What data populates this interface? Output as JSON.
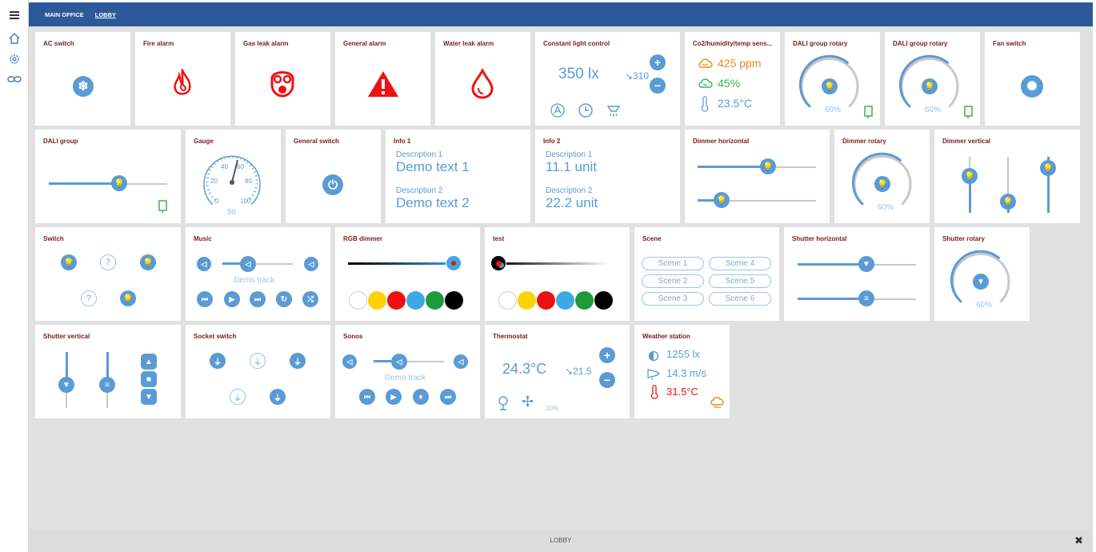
{
  "nav": {
    "breadcrumbs": [
      "MAIN OFFICE",
      "LOBBY"
    ]
  },
  "sidebar": {
    "icons": [
      "menu-icon",
      "home-icon",
      "settings-icon",
      "link-icon"
    ]
  },
  "tiles": {
    "ac_switch": {
      "title": "AC switch"
    },
    "fire_alarm": {
      "title": "Fire alarm"
    },
    "gas_leak_alarm": {
      "title": "Gas leak alarm"
    },
    "general_alarm": {
      "title": "General alarm"
    },
    "water_leak_alarm": {
      "title": "Water leak alarm"
    },
    "constant_light": {
      "title": "Constant light control",
      "value": "350 lx",
      "setpoint": "↘310"
    },
    "co2": {
      "title": "Co2/humidity/temp sens...",
      "co2": "425 ppm",
      "humidity": "45%",
      "temp": "23.5°C"
    },
    "dali_rotary_1": {
      "title": "DALI group rotary",
      "value": "60%",
      "level": 0.6
    },
    "dali_rotary_2": {
      "title": "DALI group rotary",
      "value": "60%",
      "level": 0.6
    },
    "fan_switch": {
      "title": "Fan switch"
    },
    "dali_group": {
      "title": "DALI group",
      "level": 0.6
    },
    "gauge": {
      "title": "Gauge",
      "ticks": [
        "0",
        "20",
        "40",
        "60",
        "80",
        "100"
      ],
      "value": "58"
    },
    "general_switch": {
      "title": "General switch"
    },
    "info1": {
      "title": "Info 1",
      "desc1": "Description 1",
      "val1": "Demo text 1",
      "desc2": "Description 2",
      "val2": "Demo text 2"
    },
    "info2": {
      "title": "Info 2",
      "desc1": "Description 1",
      "val1": "11.1 unit",
      "desc2": "Description 2",
      "val2": "22.2 unit"
    },
    "dimmer_horizontal": {
      "title": "Dimmer horizontal",
      "level1": 0.6,
      "level2": 0.2
    },
    "dimmer_rotary": {
      "title": "Dimmer rotary",
      "value": "60%",
      "level": 0.6
    },
    "dimmer_vertical": {
      "title": "Dimmer vertical"
    },
    "switch": {
      "title": "Switch"
    },
    "music": {
      "title": "Music",
      "track": "Demo track"
    },
    "rgb_dimmer": {
      "title": "RGB dimmer"
    },
    "test": {
      "title": "test"
    },
    "scene": {
      "title": "Scene",
      "scenes": [
        "Scene 1",
        "Scene 4",
        "Scene 2",
        "Scene 5",
        "Scene 3",
        "Scene 6"
      ]
    },
    "shutter_horizontal": {
      "title": "Shutter horizontal"
    },
    "shutter_rotary": {
      "title": "Shutter rotary",
      "value": "60%",
      "level": 0.6
    },
    "shutter_vertical": {
      "title": "Shutter vertical"
    },
    "socket_switch": {
      "title": "Socket switch"
    },
    "sonos": {
      "title": "Sonos",
      "track": "Demo track"
    },
    "thermostat": {
      "title": "Thermostat",
      "value": "24.3°C",
      "setpoint": "↘21.5",
      "fan": "30%"
    },
    "weather": {
      "title": "Weather station",
      "lux": "1255 lx",
      "wind": "14.3 m/s",
      "temp": "31.5°C"
    }
  },
  "colors": {
    "accent": "#5a9bd4",
    "header": "#2c5a99",
    "alarm": "#ee1111",
    "title": "#7a1c1c",
    "orange": "#e88a1a",
    "green": "#3cb44b",
    "swatches": [
      "#ffffff",
      "#ffd200",
      "#ee1111",
      "#3ea8e5",
      "#1e9a3a",
      "#000000"
    ]
  },
  "footer": {
    "label": "LOBBY"
  }
}
